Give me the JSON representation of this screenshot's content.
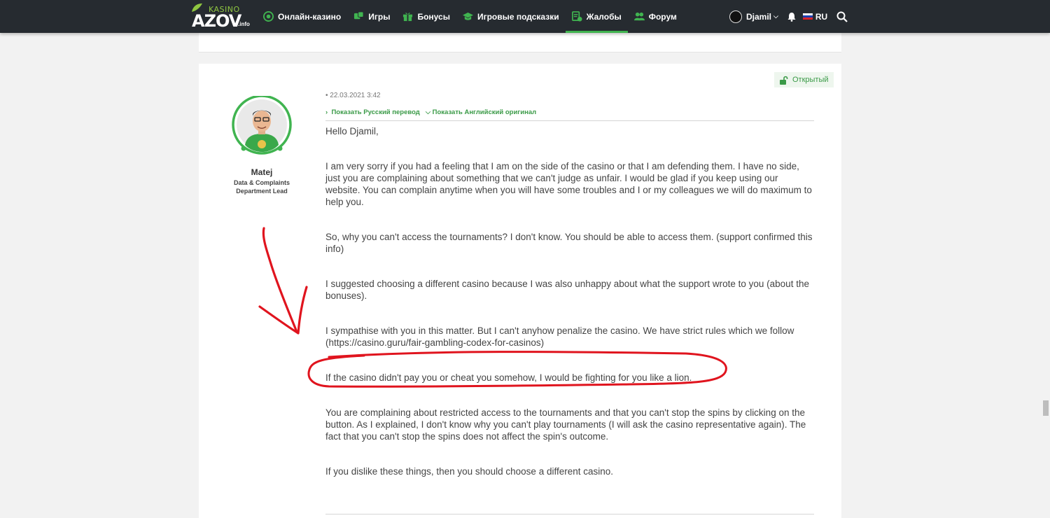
{
  "logo": {
    "top": "KASINO",
    "main": "AZOV",
    "suffix": ".info"
  },
  "nav": {
    "items": [
      {
        "label": "Онлайн-казино",
        "icon": "casino-chip-icon"
      },
      {
        "label": "Игры",
        "icon": "dice-icon"
      },
      {
        "label": "Бонусы",
        "icon": "gift-icon"
      },
      {
        "label": "Игровые подсказки",
        "icon": "graduation-cap-icon"
      },
      {
        "label": "Жалобы",
        "icon": "complaint-icon",
        "active": true
      },
      {
        "label": "Форум",
        "icon": "users-icon"
      }
    ]
  },
  "user": {
    "name": "Djamil",
    "language": "RU"
  },
  "status": {
    "label": "Открытый"
  },
  "author": {
    "name": "Matej",
    "role_line1": "Data & Complaints",
    "role_line2": "Department Lead"
  },
  "post": {
    "date": "• 22.03.2021 3:42",
    "show_translation": "Показать Русский перевод",
    "show_original": "Показать Английский оригинал",
    "paragraphs": [
      "Hello Djamil,",
      "I am very sorry if you had a feeling that I am on the side of the casino or that I am defending them. I have no side, just you are complaining about something that we can't judge as unfair. I would be glad if you keep using our website. You can complain anytime when you will have some troubles and I or my colleagues we will do maximum to help you.",
      "So, why you can't access the tournaments? I don't know. You should be able to access them. (support confirmed this info)",
      "I suggested choosing a different casino because I was also unhappy about what the support wrote to you (about the bonuses).",
      "I sympathise with you in this matter. But I can't anyhow penalize the casino. We have strict rules which we follow (https://casino.guru/fair-gambling-codex-for-casinos)",
      "If the casino didn't pay you or cheat you somehow, I would be fighting for you like a lion.",
      "You are complaining about restricted access to the tournaments and that you can't stop the spins by clicking on the button. As I explained, I don't know why you can't play tournaments (I will ask the casino representative again). The fact that you can't stop the spins does not affect the spin's outcome.",
      "If you dislike these things, then you should choose a different casino."
    ]
  },
  "colors": {
    "accent": "#40b450",
    "nav_bg": "#262b30",
    "annotation": "#e0141e"
  }
}
